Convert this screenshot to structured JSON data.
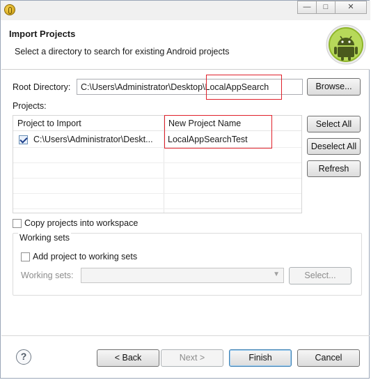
{
  "window": {
    "minimize_glyph": "—",
    "maximize_glyph": "□",
    "close_glyph": "✕"
  },
  "header": {
    "title": "Import Projects",
    "description": "Select a directory to search for existing Android projects"
  },
  "root_directory": {
    "label": "Root Directory:",
    "value": "C:\\Users\\Administrator\\Desktop\\LocalAppSearch",
    "browse_label": "Browse..."
  },
  "projects": {
    "label": "Projects:",
    "columns": [
      "Project to Import",
      "New Project Name"
    ],
    "rows": [
      {
        "checked": true,
        "path": "C:\\Users\\Administrator\\Deskt...",
        "new_name": "LocalAppSearchTest"
      }
    ],
    "select_all_label": "Select All",
    "deselect_all_label": "Deselect All",
    "refresh_label": "Refresh"
  },
  "copy_into_workspace": {
    "label": "Copy projects into workspace",
    "checked": false
  },
  "working_sets": {
    "group_label": "Working sets",
    "add_label": "Add project to working sets",
    "add_checked": false,
    "field_label": "Working sets:",
    "select_label": "Select..."
  },
  "footer": {
    "help_glyph": "?",
    "back_label": "< Back",
    "next_label": "Next >",
    "finish_label": "Finish",
    "cancel_label": "Cancel"
  },
  "colors": {
    "highlight_box": "#e0202a",
    "android_green": "#97c024"
  }
}
